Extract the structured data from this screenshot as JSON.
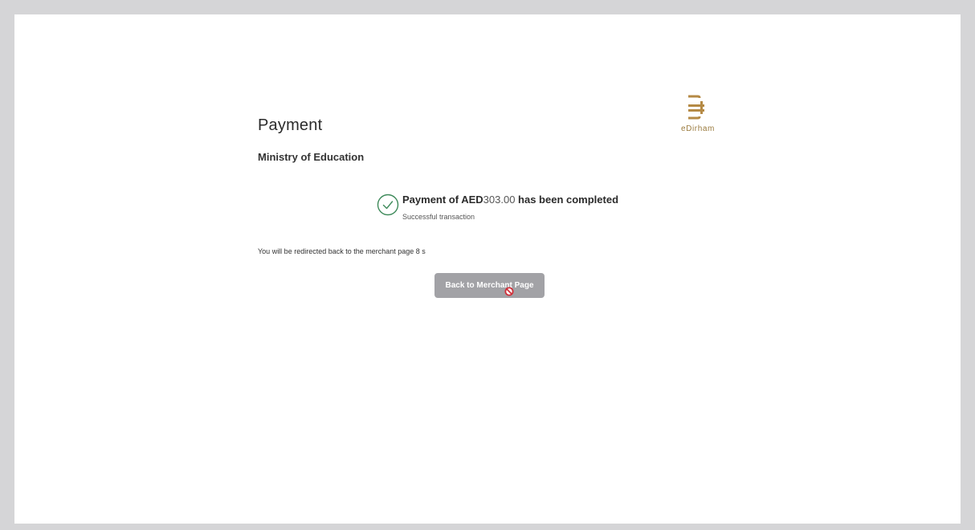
{
  "page": {
    "title": "Payment",
    "merchant_name": "Ministry of Education"
  },
  "logo": {
    "text": "eDirham",
    "icon": "edirham-logo-icon",
    "color": "#b58a45"
  },
  "status": {
    "icon": "check-circle-icon",
    "prefix": "Payment of AED",
    "amount": "303.00",
    "suffix": "has been completed",
    "subtext": "Successful transaction",
    "color": "#3e8a5a"
  },
  "redirect": {
    "text": "You will be redirected back to the merchant page 8 s"
  },
  "actions": {
    "back_label": "Back to Merchant Page",
    "cursor_icon": "not-allowed-icon"
  }
}
